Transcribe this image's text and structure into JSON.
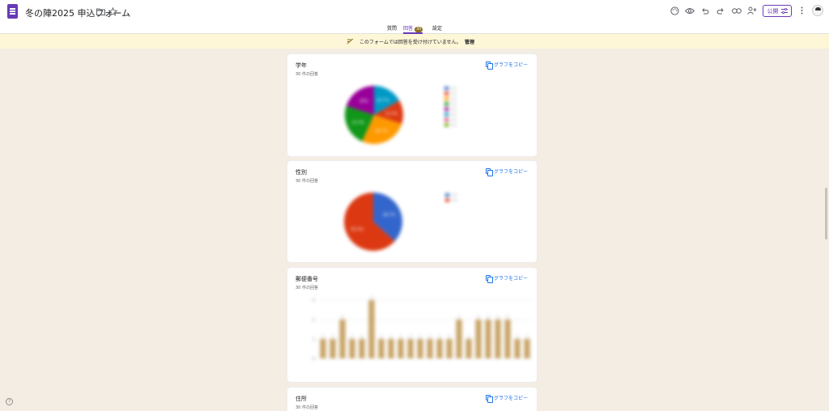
{
  "header": {
    "title": "冬の陣2025 申込フォーム",
    "folder_icon": "folder-icon",
    "star_icon": "star-icon",
    "toolbar_icons": [
      "palette-icon",
      "preview-eye-icon",
      "undo-icon",
      "redo-icon",
      "link-icon",
      "add-collaborator-icon"
    ],
    "publish_label": "公開",
    "more_icon": "more-vert-icon"
  },
  "tabs": {
    "questions": "質問",
    "responses": "回答",
    "responses_count": "30",
    "settings": "設定"
  },
  "banner": {
    "message": "このフォームでは回答を受け付けていません。",
    "manage": "管理"
  },
  "copy_label": "グラフをコピー",
  "cards": [
    {
      "title": "学年",
      "count": "30 件の回答"
    },
    {
      "title": "性別",
      "count": "30 件の回答"
    },
    {
      "title": "郵便番号",
      "count": "30 件の回答"
    },
    {
      "title": "住所",
      "count": "30 件の回答"
    }
  ],
  "colors": {
    "accent": "#673ab7",
    "banner": "#fdf6d7",
    "background": "#f4ede4",
    "bar": "#c9a56a",
    "link": "#1a73e8"
  },
  "chart_data": [
    {
      "type": "pie",
      "slices": [
        {
          "value": 16.7,
          "color": "#0099c6"
        },
        {
          "value": 13.3,
          "color": "#dc3912"
        },
        {
          "value": 26.7,
          "color": "#ff9900"
        },
        {
          "value": 23.3,
          "color": "#109618"
        },
        {
          "value": 20.0,
          "color": "#990099"
        }
      ],
      "legend_colors": [
        "#3366cc",
        "#dc3912",
        "#ff9900",
        "#109618",
        "#990099",
        "#0099c6",
        "#dd4477",
        "#66aa00"
      ]
    },
    {
      "type": "pie",
      "slices": [
        {
          "value": 36.7,
          "color": "#3366cc"
        },
        {
          "value": 63.3,
          "color": "#dc3912"
        }
      ],
      "legend_colors": [
        "#3366cc",
        "#dc3912"
      ]
    },
    {
      "type": "bar",
      "values": [
        1,
        1,
        2,
        1,
        1,
        3,
        1,
        1,
        1,
        1,
        1,
        1,
        1,
        1,
        2,
        1,
        2,
        2,
        2,
        2,
        1,
        1
      ],
      "ylim": [
        0,
        3
      ],
      "yticks": [
        0,
        1,
        2,
        3
      ],
      "color": "#c9a56a"
    }
  ]
}
